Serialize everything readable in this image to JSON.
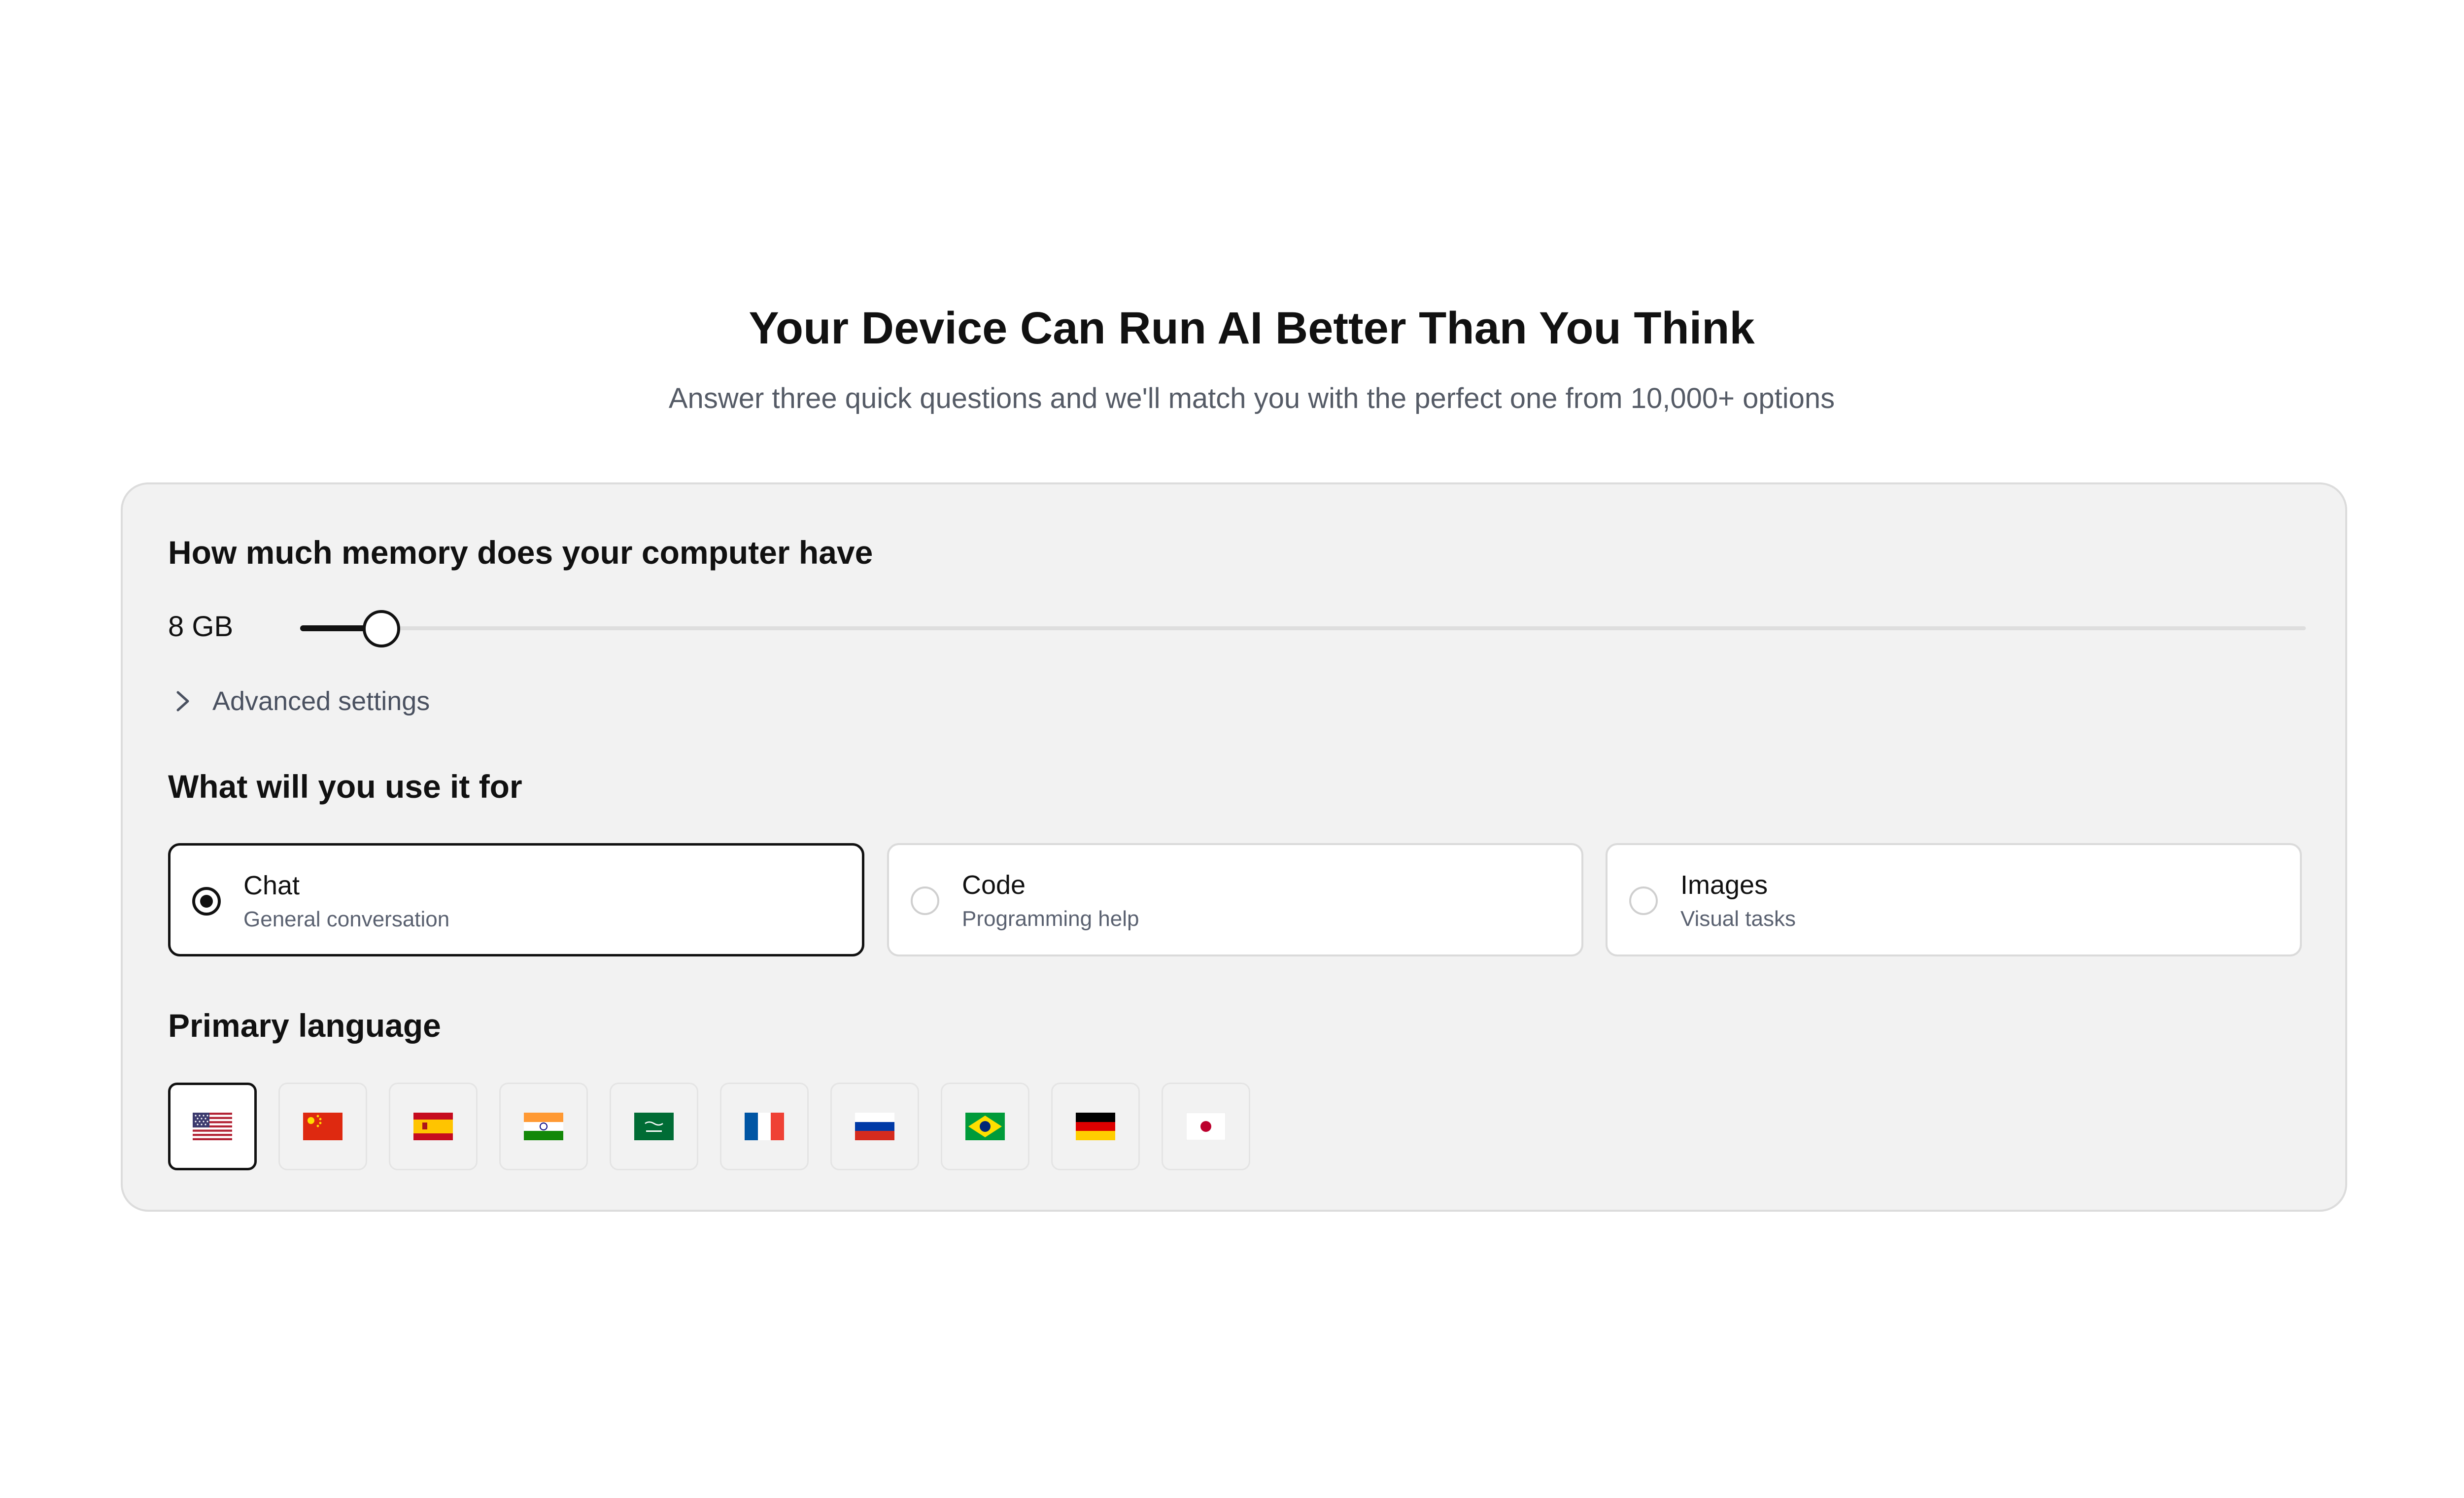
{
  "hero": {
    "title": "Your Device Can Run AI Better Than You Think",
    "subtitle": "Answer three quick questions and we'll match you with the perfect one from 10,000+ options"
  },
  "memory": {
    "title": "How much memory does your computer have",
    "value_label": "8 GB",
    "slider_fraction": 0.04
  },
  "advanced": {
    "label": "Advanced settings",
    "icon": "chevron-right-icon",
    "expanded": false
  },
  "usage": {
    "title": "What will you use it for",
    "options": [
      {
        "title": "Chat",
        "description": "General conversation",
        "selected": true
      },
      {
        "title": "Code",
        "description": "Programming help",
        "selected": false
      },
      {
        "title": "Images",
        "description": "Visual tasks",
        "selected": false
      }
    ]
  },
  "language": {
    "title": "Primary language",
    "flags": [
      {
        "flag": "us-flag-icon",
        "selected": true
      },
      {
        "flag": "cn-flag-icon",
        "selected": false
      },
      {
        "flag": "es-flag-icon",
        "selected": false
      },
      {
        "flag": "in-flag-icon",
        "selected": false
      },
      {
        "flag": "sa-flag-icon",
        "selected": false
      },
      {
        "flag": "fr-flag-icon",
        "selected": false
      },
      {
        "flag": "ru-flag-icon",
        "selected": false
      },
      {
        "flag": "br-flag-icon",
        "selected": false
      },
      {
        "flag": "de-flag-icon",
        "selected": false
      },
      {
        "flag": "jp-flag-icon",
        "selected": false
      }
    ]
  },
  "colors": {
    "accent": "#111111",
    "card_background": "#f2f2f2",
    "subtitle_text": "#555b66"
  }
}
